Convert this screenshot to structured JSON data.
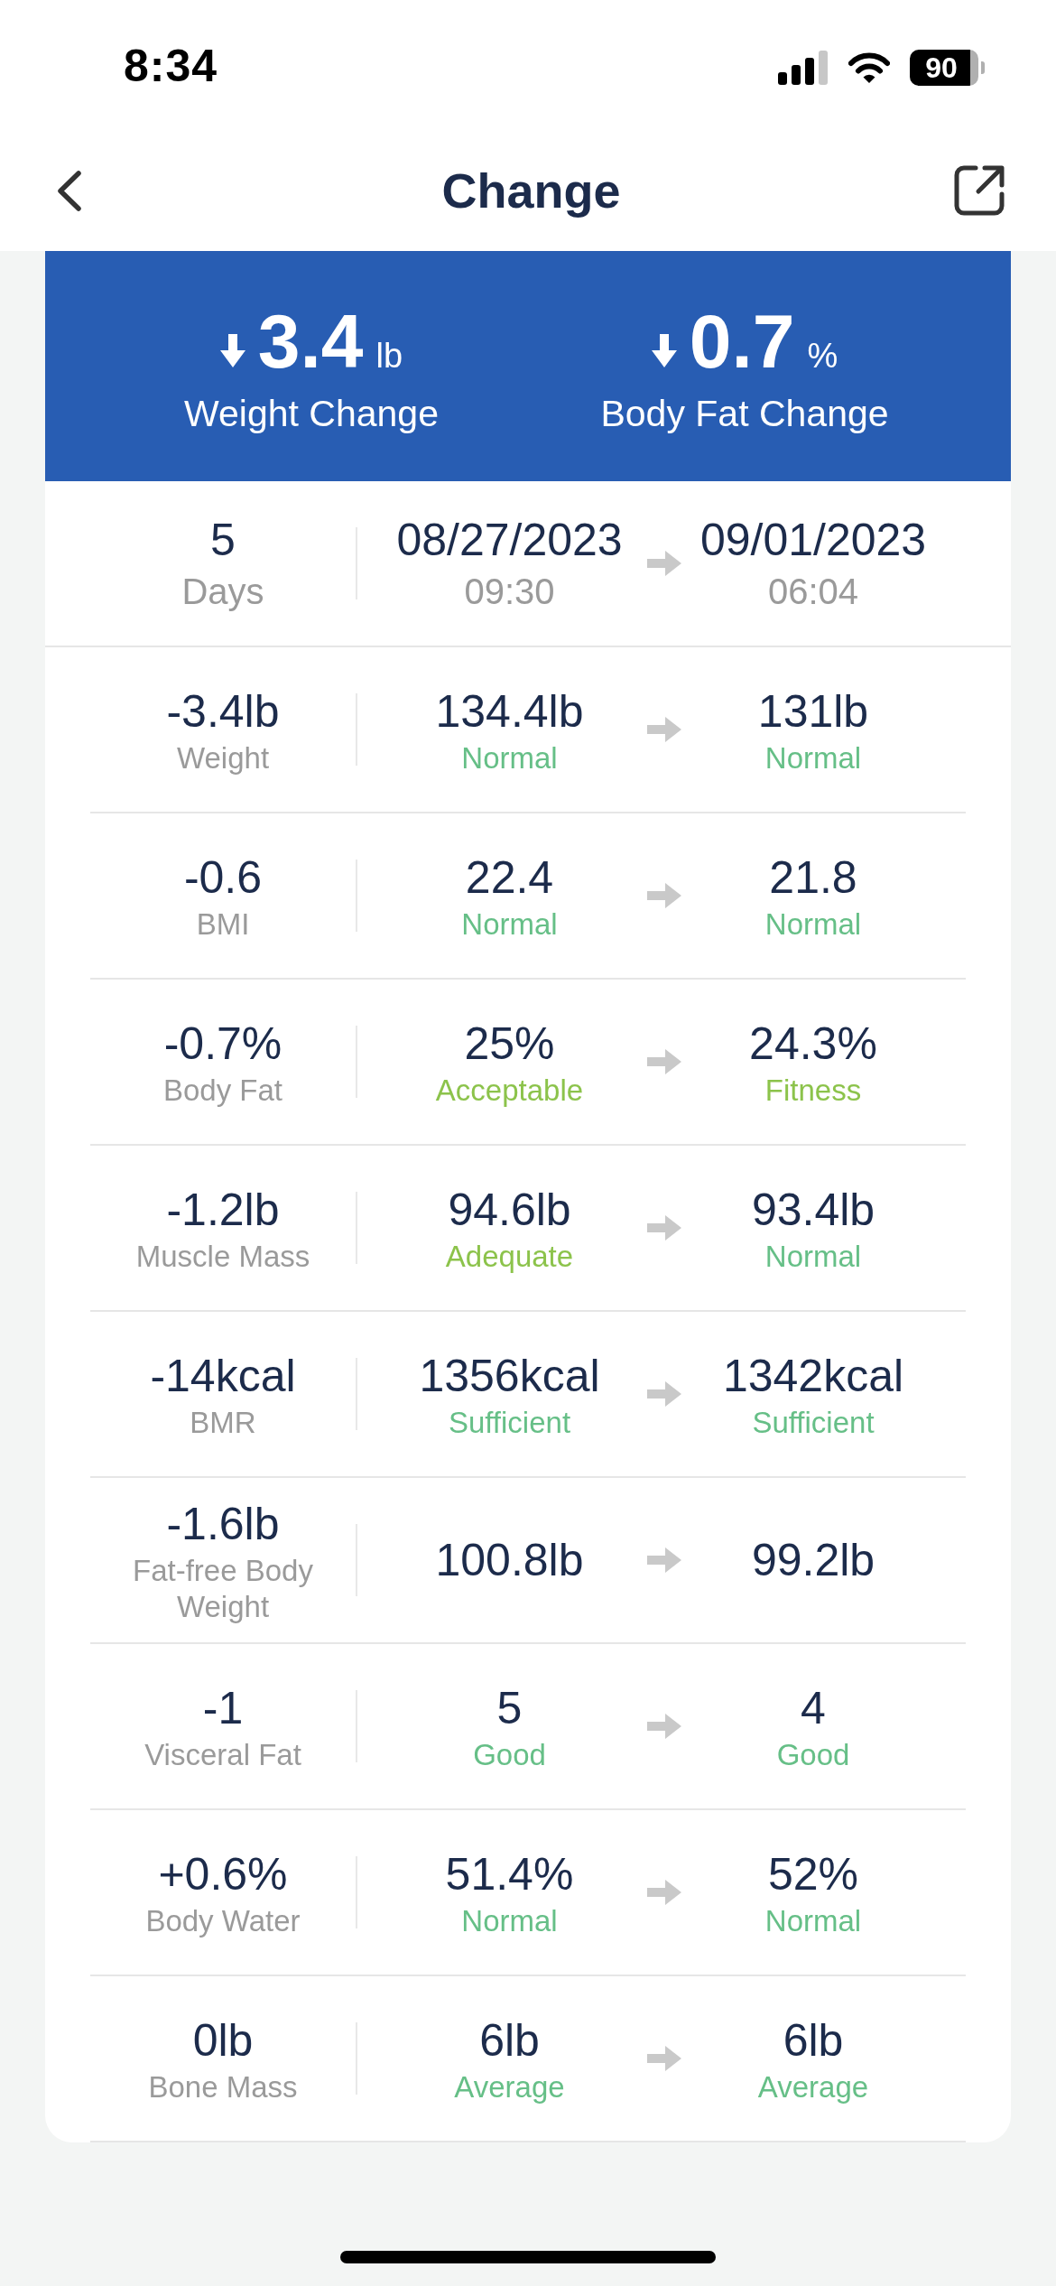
{
  "status_bar": {
    "time": "8:34",
    "battery": "90"
  },
  "header": {
    "title": "Change"
  },
  "summary": [
    {
      "decrease": true,
      "value": "3.4",
      "unit": "lb",
      "label": "Weight Change"
    },
    {
      "decrease": true,
      "value": "0.7",
      "unit": "%",
      "label": "Body Fat Change"
    }
  ],
  "period": {
    "days": "5",
    "days_label": "Days",
    "start": {
      "date": "08/27/2023",
      "time": "09:30"
    },
    "end": {
      "date": "09/01/2023",
      "time": "06:04"
    }
  },
  "metrics": [
    {
      "change": "-3.4lb",
      "name": "Weight",
      "before": {
        "value": "134.4lb",
        "status": "Normal",
        "color": "#66bf87"
      },
      "after": {
        "value": "131lb",
        "status": "Normal",
        "color": "#66bf87"
      }
    },
    {
      "change": "-0.6",
      "name": "BMI",
      "before": {
        "value": "22.4",
        "status": "Normal",
        "color": "#66bf87"
      },
      "after": {
        "value": "21.8",
        "status": "Normal",
        "color": "#66bf87"
      }
    },
    {
      "change": "-0.7%",
      "name": "Body Fat",
      "before": {
        "value": "25%",
        "status": "Acceptable",
        "color": "#8cc34b"
      },
      "after": {
        "value": "24.3%",
        "status": "Fitness",
        "color": "#8cc34b"
      }
    },
    {
      "change": "-1.2lb",
      "name": "Muscle Mass",
      "before": {
        "value": "94.6lb",
        "status": "Adequate",
        "color": "#8cc34b"
      },
      "after": {
        "value": "93.4lb",
        "status": "Normal",
        "color": "#66bf87"
      }
    },
    {
      "change": "-14kcal",
      "name": "BMR",
      "before": {
        "value": "1356kcal",
        "status": "Sufficient",
        "color": "#66bf87"
      },
      "after": {
        "value": "1342kcal",
        "status": "Sufficient",
        "color": "#66bf87"
      }
    },
    {
      "change": "-1.6lb",
      "name": "Fat-free Body Weight",
      "before": {
        "value": "100.8lb"
      },
      "after": {
        "value": "99.2lb"
      }
    },
    {
      "change": "-1",
      "name": "Visceral Fat",
      "before": {
        "value": "5",
        "status": "Good",
        "color": "#66bf87"
      },
      "after": {
        "value": "4",
        "status": "Good",
        "color": "#66bf87"
      }
    },
    {
      "change": "+0.6%",
      "name": "Body Water",
      "before": {
        "value": "51.4%",
        "status": "Normal",
        "color": "#66bf87"
      },
      "after": {
        "value": "52%",
        "status": "Normal",
        "color": "#66bf87"
      }
    },
    {
      "change": "0lb",
      "name": "Bone Mass",
      "before": {
        "value": "6lb",
        "status": "Average",
        "color": "#66bf87"
      },
      "after": {
        "value": "6lb",
        "status": "Average",
        "color": "#66bf87"
      }
    }
  ]
}
